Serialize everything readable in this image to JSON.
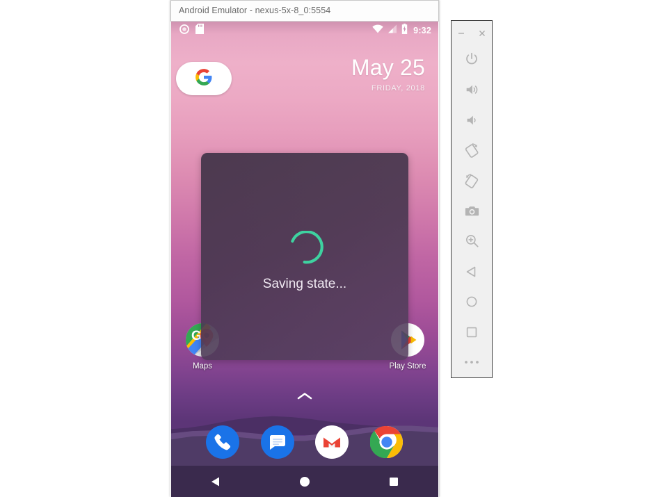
{
  "window": {
    "title": "Android Emulator - nexus-5x-8_0:5554"
  },
  "status_bar": {
    "left_icons": [
      "record-circle-icon",
      "sd-card-icon"
    ],
    "right_icons": [
      "wifi-icon",
      "cell-signal-icon",
      "battery-charging-icon"
    ],
    "clock": "9:32"
  },
  "date_widget": {
    "day": "May 25",
    "subtitle": "FRIDAY, 2018"
  },
  "search_widget": {
    "icon": "google-g-icon"
  },
  "dialog": {
    "message": "Saving state...",
    "spinner_color": "#3ed2a0",
    "background_color": "#463648"
  },
  "home_apps": [
    {
      "name": "Maps",
      "icon": "google-maps-icon"
    },
    {
      "name": "Play Store",
      "icon": "google-play-store-icon"
    }
  ],
  "drawer": {
    "icon": "chevron-up-icon"
  },
  "dock_apps": [
    {
      "name": "Phone",
      "icon": "phone-icon"
    },
    {
      "name": "Messages",
      "icon": "messages-icon"
    },
    {
      "name": "Gmail",
      "icon": "gmail-icon"
    },
    {
      "name": "Chrome",
      "icon": "chrome-icon"
    }
  ],
  "nav_bar": [
    {
      "name": "Back",
      "icon": "back-triangle-icon"
    },
    {
      "name": "Home",
      "icon": "home-circle-icon"
    },
    {
      "name": "Overview",
      "icon": "overview-square-icon"
    }
  ],
  "emulator_toolbar": {
    "window_controls": [
      {
        "name": "Minimize",
        "icon": "minimize-icon",
        "glyph": "–"
      },
      {
        "name": "Close",
        "icon": "close-icon",
        "glyph": "×"
      }
    ],
    "buttons": [
      {
        "name": "Power",
        "icon": "power-icon"
      },
      {
        "name": "Volume Up",
        "icon": "volume-up-icon"
      },
      {
        "name": "Volume Down",
        "icon": "volume-down-icon"
      },
      {
        "name": "Rotate Left",
        "icon": "rotate-left-icon"
      },
      {
        "name": "Rotate Right",
        "icon": "rotate-right-icon"
      },
      {
        "name": "Take Screenshot",
        "icon": "camera-icon"
      },
      {
        "name": "Zoom",
        "icon": "zoom-in-icon"
      },
      {
        "name": "Back",
        "icon": "back-triangle-icon"
      },
      {
        "name": "Home",
        "icon": "home-circle-icon"
      },
      {
        "name": "Overview",
        "icon": "overview-square-icon"
      },
      {
        "name": "More",
        "icon": "more-dots-icon"
      }
    ]
  },
  "colors": {
    "wallpaper_top": "#eeb0c9",
    "wallpaper_bottom": "#5c3577",
    "dock_hill": "#4f3b66",
    "accent_teal": "#3ed2a0",
    "toolbar_bg": "#f0f0f0"
  }
}
